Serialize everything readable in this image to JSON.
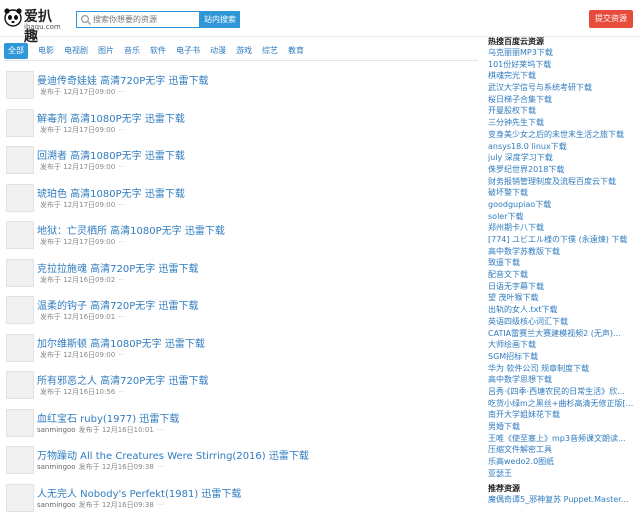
{
  "header": {
    "logo_cn": "爱扒趣",
    "logo_en": "ibaqu.com",
    "search_placeholder": "搜索你想要的资源",
    "search_button": "站内搜索",
    "submit_button": "提交资源"
  },
  "nav": {
    "items": [
      "全部",
      "电影",
      "电视剧",
      "图片",
      "音乐",
      "软件",
      "电子书",
      "动漫",
      "游戏",
      "综艺",
      "教育"
    ]
  },
  "list": [
    {
      "title": "曼迪传奇娃娃 高清720P无字 迅雷下载",
      "user": "",
      "time": "发布于 12月17日09:00"
    },
    {
      "title": "解毒剂 高清1080P无字 迅雷下载",
      "user": "",
      "time": "发布于 12月17日09:00"
    },
    {
      "title": "回溯者 高清1080P无字 迅雷下载",
      "user": "",
      "time": "发布于 12月17日09:00"
    },
    {
      "title": "琥珀色 高清1080P无字 迅雷下载",
      "user": "",
      "time": "发布于 12月17日09:00"
    },
    {
      "title": "地狱：亡灵栖所 高清1080P无字 迅雷下载",
      "user": "",
      "time": "发布于 12月17日09:00"
    },
    {
      "title": "克拉拉施魂 高清720P无字 迅雷下载",
      "user": "",
      "time": "发布于 12月16日09:02"
    },
    {
      "title": "温柔的钩子 高清720P无字 迅雷下载",
      "user": "",
      "time": "发布于 12月16日09:01"
    },
    {
      "title": "加尔维斯顿 高清1080P无字 迅雷下载",
      "user": "",
      "time": "发布于 12月16日09:00"
    },
    {
      "title": "所有邪恶之人 高清720P无字 迅雷下载",
      "user": "",
      "time": "发布于 12月16日10:56"
    },
    {
      "title": "血红宝石 ruby(1977) 迅雷下载",
      "user": "sanmingoo",
      "time": "发布于 12月16日10:01"
    },
    {
      "title": "万物躁动 All the Creatures Were Stirring(2016) 迅雷下载",
      "user": "sanmingoo",
      "time": "发布于 12月16日09:38"
    },
    {
      "title": "人无完人 Nobody's Perfekt(1981) 迅雷下载",
      "user": "sanmingoo",
      "time": "发布于 12月16日09:38"
    }
  ],
  "sidebar": {
    "hot_heading": "热搜百度云资源",
    "hot_links": [
      "乌克丽丽MP3下载",
      "101份好莱坞下载",
      "棋魂完光下载",
      "武汉大学信号与系统考研下载",
      "桜日梯子合集下载",
      "开曼股权下载",
      "三分钟先生下载",
      "变身美少女之后的未世末生活之旅下载",
      "ansys18.0 linux下载",
      "july 深度学习下载",
      "侏罗纪世界2018下载",
      "财务报销管理制度及流程百度云下载",
      "破坏警下载",
      "goodgupiao下载",
      "soler下载",
      "郑州期卡八下载",
      "[774] ユビエル様の下僕 (永遠煉) 下载",
      "高中数学苏教版下载",
      "致遥下载",
      "配音文下载",
      "日语无字幕下载",
      "望 茂叶猴下载",
      "出轨的女人.txt下载",
      "英语四级核心词汇下载",
      "CATIA雷赛兰大赛建模视频2 (无声)...",
      "大师绘画下载",
      "SGM招标下载",
      "华为 软件公司 规章制度下载",
      "高中数学思想下载",
      "吕秀·《四季·西塘农民的日常生活》欣...",
      "吃货小绿m之黑丝+曲杉高清无修正版[...",
      "南开大学姐妹花下载",
      "男婚下载",
      "王唯《使至塞上》mp3音频课文朗读...",
      "压缩文件解密工具",
      "乐高wedo2.0图纸",
      "亚瑟王"
    ],
    "rec_heading": "推荐资源",
    "rec_links": [
      "魔偶奇谭5_邪神复苏 Puppet.Master..."
    ]
  }
}
